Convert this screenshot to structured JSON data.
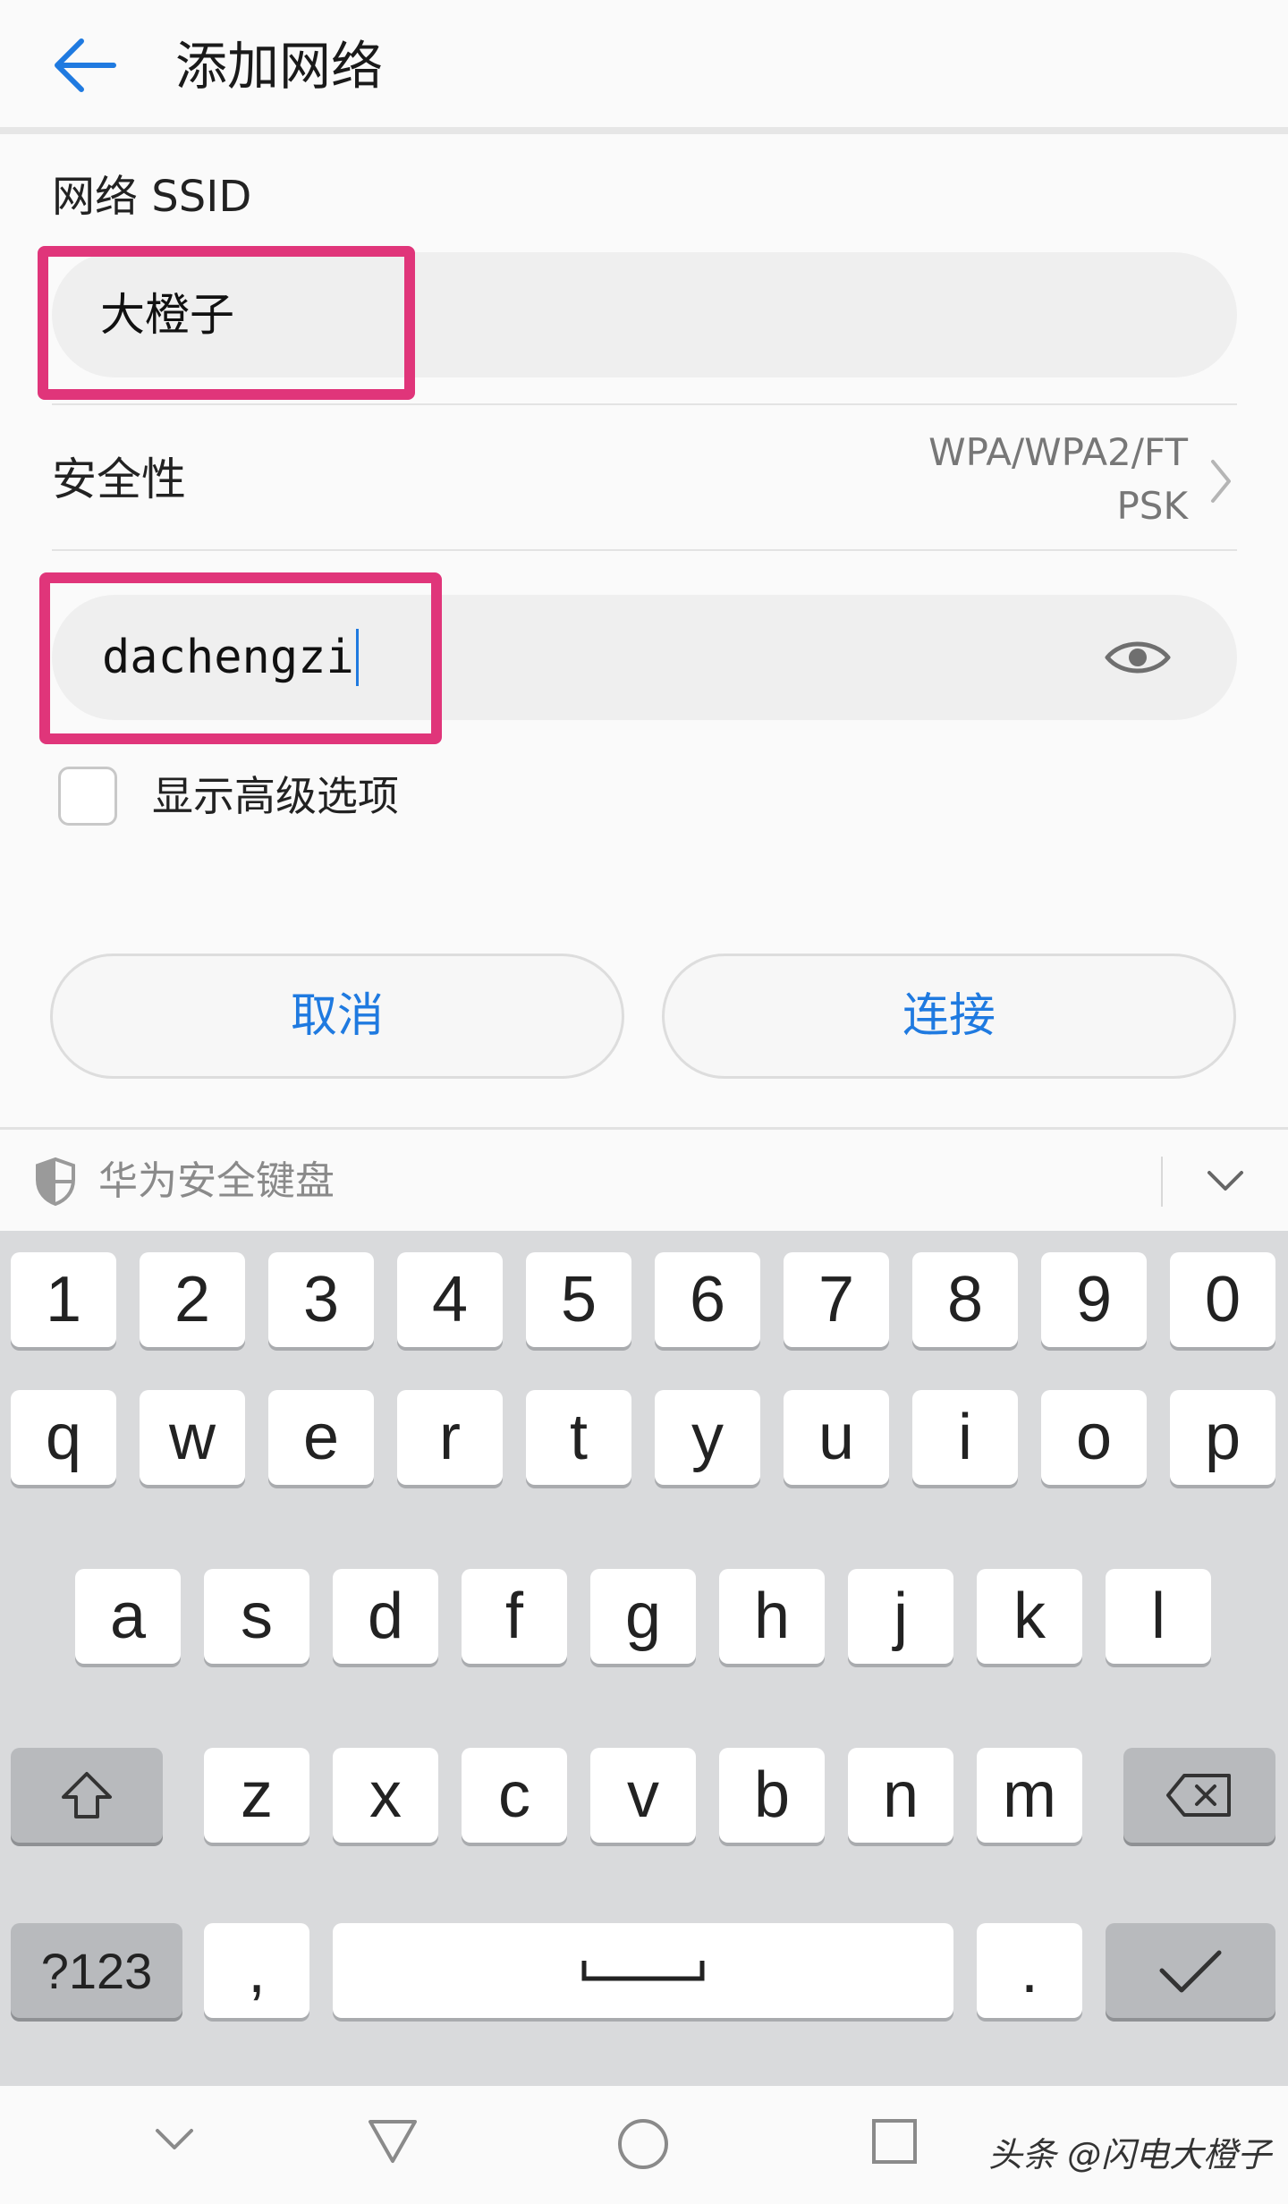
{
  "header": {
    "title": "添加网络",
    "back_icon": "arrow-left-icon"
  },
  "form": {
    "ssid_label": "网络 SSID",
    "ssid_value": "大橙子",
    "security_label": "安全性",
    "security_value_line1": "WPA/WPA2/FT",
    "security_value_line2": "PSK",
    "password_value": "dachengzi",
    "show_advanced_label": "显示高级选项",
    "show_advanced_checked": false
  },
  "buttons": {
    "cancel": "取消",
    "connect": "连接"
  },
  "colors": {
    "accent": "#1f7ae0",
    "highlight": "#e0357a"
  },
  "keyboard": {
    "name": "华为安全键盘",
    "row_numbers": [
      "1",
      "2",
      "3",
      "4",
      "5",
      "6",
      "7",
      "8",
      "9",
      "0"
    ],
    "row_1": [
      "q",
      "w",
      "e",
      "r",
      "t",
      "y",
      "u",
      "i",
      "o",
      "p"
    ],
    "row_2": [
      "a",
      "s",
      "d",
      "f",
      "g",
      "h",
      "j",
      "k",
      "l"
    ],
    "row_3": [
      "z",
      "x",
      "c",
      "v",
      "b",
      "n",
      "m"
    ],
    "symbols_key": "?123",
    "comma_key": ",",
    "period_key": ".",
    "shift_icon": "shift-arrow-icon",
    "backspace_icon": "backspace-icon",
    "enter_icon": "checkmark-icon",
    "space_icon": "space-bar-icon"
  },
  "navbar": {
    "icons": [
      "chevron-down-icon",
      "back-triangle-icon",
      "home-circle-icon",
      "recents-square-icon"
    ],
    "watermark": "头条 @闪电大橙子"
  }
}
